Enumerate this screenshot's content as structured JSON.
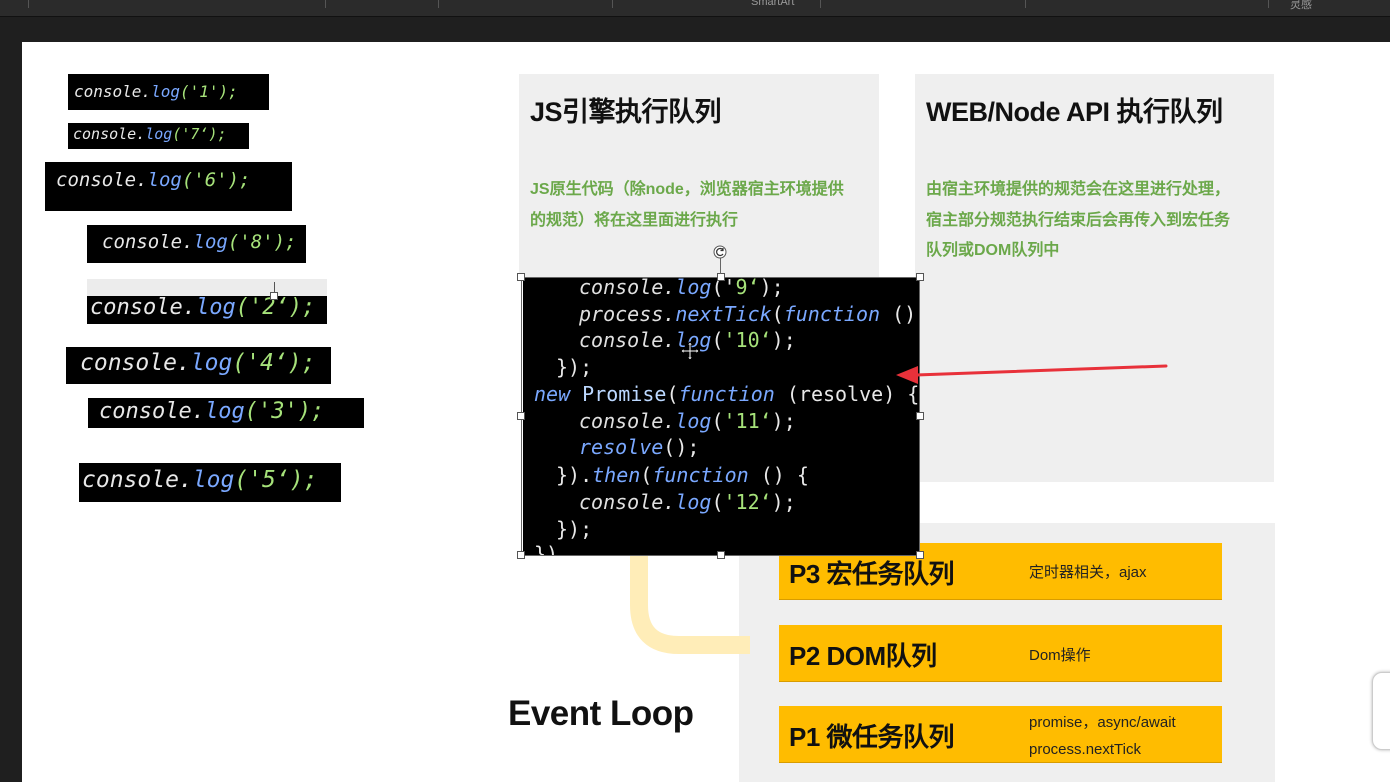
{
  "toolbar": {
    "smartart_label": "SmartArt",
    "right_label": "灵感"
  },
  "snippets": [
    {
      "text_prefix": "console.",
      "fn": "log",
      "arg": "('1');"
    },
    {
      "text_prefix": "console.",
      "fn": "log",
      "arg": "('7‘);"
    },
    {
      "text_prefix": "console.",
      "fn": "log",
      "arg": "('6');"
    },
    {
      "text_prefix": "console.",
      "fn": "log",
      "arg": "('8');"
    },
    {
      "text_prefix": "console.",
      "fn": "log",
      "arg": "('2‘);"
    },
    {
      "text_prefix": "console.",
      "fn": "log",
      "arg": "('4‘);"
    },
    {
      "text_prefix": "console.",
      "fn": "log",
      "arg": "('3');"
    },
    {
      "text_prefix": "console.",
      "fn": "log",
      "arg": "('5‘);"
    }
  ],
  "js_panel": {
    "title": "JS引擎执行队列",
    "desc_line1": "JS原生代码（除node，浏览器宿主环境提供",
    "desc_line2": "的规范）将在这里面进行执行"
  },
  "web_panel": {
    "title": "WEB/Node API 执行队列",
    "desc_line1": "由宿主环境提供的规范会在这里进行处理，",
    "desc_line2": "宿主部分规范执行结束后会再传入到宏任务",
    "desc_line3": "队列或DOM队列中"
  },
  "queues": [
    {
      "title": "P3 宏任务队列",
      "desc1": "定时器相关，ajax",
      "desc2": ""
    },
    {
      "title": "P2 DOM队列",
      "desc1": "Dom操作",
      "desc2": ""
    },
    {
      "title": "P1 微任务队列",
      "desc1": "promise，async/await",
      "desc2": "process.nextTick"
    }
  ],
  "event_loop_label": "Event Loop",
  "big_code": {
    "l1_a": "console.",
    "l1_f": "log",
    "l1_b": "('",
    "l1_s": "9‘",
    "l1_c": ");",
    "l2_a": "process.",
    "l2_f": "nextTick",
    "l2_b": "(",
    "l2_kw": "function",
    "l2_c": " () {",
    "l3_a": "console.",
    "l3_f": "log",
    "l3_b": "(",
    "l3_s": "'10‘",
    "l3_c": ");",
    "l4": "});",
    "l5_kw": "new",
    "l5_cl": " Promise",
    "l5_b": "(",
    "l5_kw2": "function",
    "l5_c": " (resolve) {",
    "l6_a": "console.",
    "l6_f": "log",
    "l6_b": "(",
    "l6_s": "'11‘",
    "l6_c": ");",
    "l7_f": "resolve",
    "l7_c": "();",
    "l8_a": "}).",
    "l8_f": "then",
    "l8_b": "(",
    "l8_kw": "function",
    "l8_c": " () {",
    "l9_a": "console.",
    "l9_f": "log",
    "l9_b": "(",
    "l9_s": "'12‘",
    "l9_c": ");",
    "l10": "});",
    "l11": "})"
  },
  "colors": {
    "accent": "#ffbc00",
    "green_text": "#6ba84a",
    "panel_bg": "#efefef",
    "arrow": "#e8313a"
  }
}
